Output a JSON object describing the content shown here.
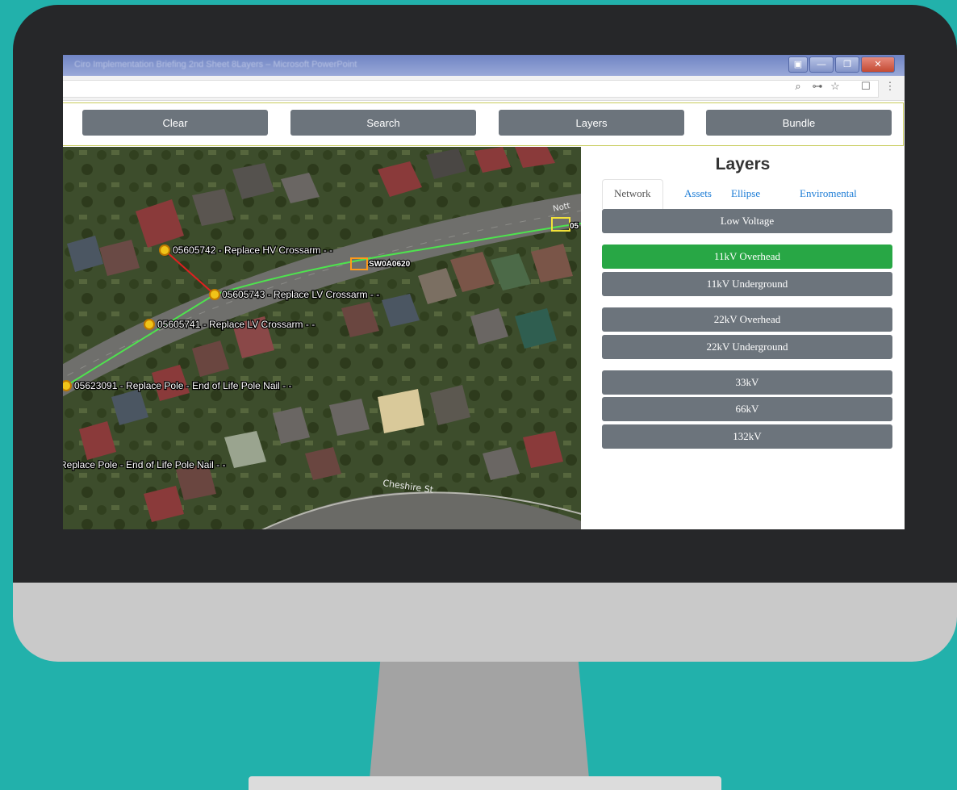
{
  "window": {
    "title": "Ciro Implementation Briefing 2nd Sheet 8Layers – Microsoft PowerPoint",
    "controls": {
      "minimize": "—",
      "restore": "❐",
      "close": "✕"
    }
  },
  "browser": {
    "icons": {
      "zoom": "⌕",
      "key": "⊶",
      "star": "☆",
      "extension": "☐",
      "menu": "⋮"
    }
  },
  "toolbar": {
    "clear": "Clear",
    "search": "Search",
    "layers": "Layers",
    "bundle": "Bundle"
  },
  "map": {
    "assets": [
      {
        "label": "05605742 - Replace HV Crossarm - -"
      },
      {
        "label": "05605743 - Replace LV Crossarm - -"
      },
      {
        "label": "05605741 - Replace LV Crossarm - -"
      },
      {
        "label": "05623091 - Replace Pole - End of Life Pole Nail - -"
      },
      {
        "label": "Replace Pole - End of Life Pole Nail - -"
      }
    ],
    "switch_label": "SW0A0620",
    "street_north": "Nott",
    "street_north_tag": "05",
    "street_south": "Cheshire St"
  },
  "layers_panel": {
    "title": "Layers",
    "tabs": [
      "Network",
      "Assets",
      "Ellipse",
      "Enviromental"
    ],
    "items": [
      {
        "label": "Low Voltage",
        "active": false
      },
      {
        "label": "11kV Overhead",
        "active": true
      },
      {
        "label": "11kV Underground",
        "active": false
      },
      {
        "label": "22kV Overhead",
        "active": false
      },
      {
        "label": "22kV Underground",
        "active": false
      },
      {
        "label": "33kV",
        "active": false
      },
      {
        "label": "66kV",
        "active": false
      },
      {
        "label": "132kV",
        "active": false
      }
    ]
  },
  "colors": {
    "background": "#22b1ab",
    "button": "#6c747c",
    "active_layer": "#28a745",
    "active_line": "#4ee34e",
    "fault_line": "#e02020",
    "pole_marker": "#f0c419",
    "tab_link": "#1e7dd6"
  }
}
